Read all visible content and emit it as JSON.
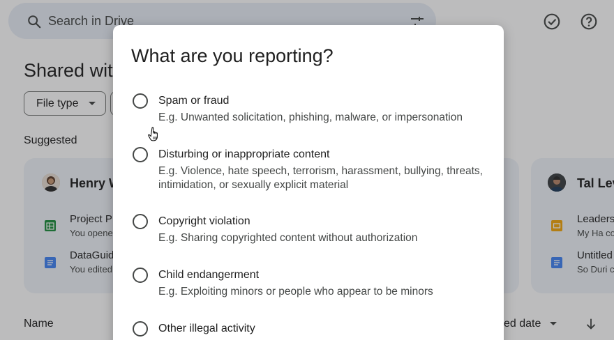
{
  "search": {
    "placeholder": "Search in Drive"
  },
  "page": {
    "title": "Shared wit",
    "filter_chip": "File type",
    "suggested_label": "Suggested"
  },
  "cards": {
    "left": {
      "person": "Henry W",
      "files": [
        {
          "title": "Project P",
          "subtitle": "You opene",
          "type": "sheets",
          "color": "#1e8e3e"
        },
        {
          "title": "DataGuid",
          "subtitle": "You edited",
          "type": "docs",
          "color": "#4285f4"
        }
      ]
    },
    "right": {
      "person": "Tal Lev",
      "files": [
        {
          "title": "Leaders",
          "subtitle": "My Ha co",
          "type": "slides",
          "color": "#f2a60c"
        },
        {
          "title": "Untitled",
          "subtitle": "So Duri c",
          "type": "docs",
          "color": "#4285f4"
        }
      ]
    }
  },
  "table": {
    "name_header": "Name",
    "date_header": "ed date"
  },
  "dialog": {
    "title": "What are you reporting?",
    "options": [
      {
        "label": "Spam or fraud",
        "description": "E.g. Unwanted solicitation, phishing, malware, or impersonation"
      },
      {
        "label": "Disturbing or inappropriate content",
        "description": "E.g. Violence, hate speech, terrorism, harassment, bullying, threats, intimidation, or sexually explicit material"
      },
      {
        "label": "Copyright violation",
        "description": "E.g. Sharing copyrighted content without authorization"
      },
      {
        "label": "Child endangerment",
        "description": "E.g. Exploiting minors or people who appear to be minors"
      },
      {
        "label": "Other illegal activity",
        "description": ""
      }
    ]
  },
  "icons": {
    "search": "search-icon",
    "tune": "tune-icon",
    "tasks": "check-circle-icon",
    "help": "help-icon",
    "sort": "arrow-down-icon",
    "cursor": "hand-pointer-icon"
  }
}
